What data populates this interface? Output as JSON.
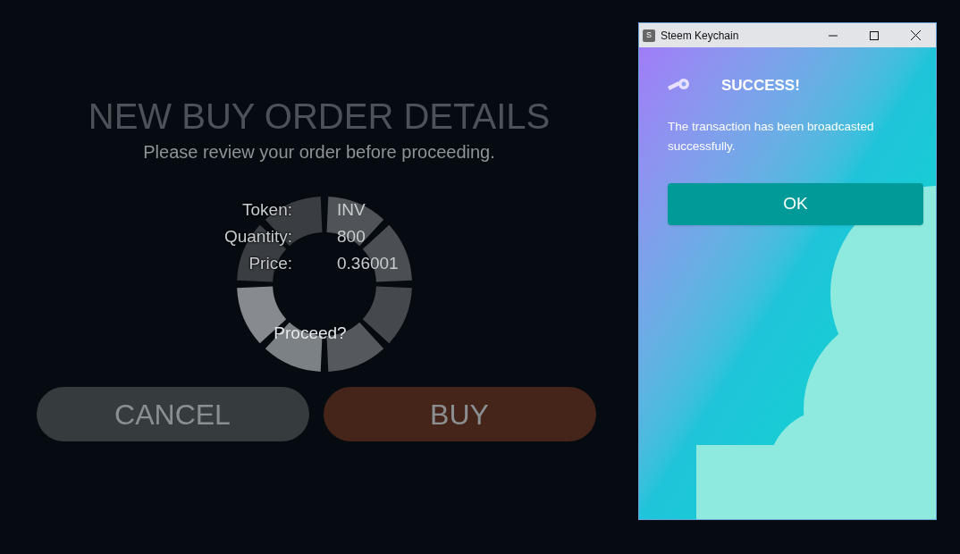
{
  "order_dialog": {
    "title": "NEW BUY ORDER DETAILS",
    "subtitle": "Please review your order before proceeding.",
    "details": [
      {
        "label": "Token:",
        "value": "INV"
      },
      {
        "label": "Quantity:",
        "value": "800"
      },
      {
        "label": "Price:",
        "value": "0.36001"
      }
    ],
    "prompt": "Proceed?",
    "buttons": [
      {
        "kind": "cancel",
        "label": "CANCEL"
      },
      {
        "kind": "buy",
        "label": "BUY"
      }
    ]
  },
  "popup_window": {
    "title": "Steem Keychain",
    "app_icon_letter": "S",
    "heading": "SUCCESS!",
    "message": "The transaction has been broadcasted successfully.",
    "button": "OK"
  }
}
